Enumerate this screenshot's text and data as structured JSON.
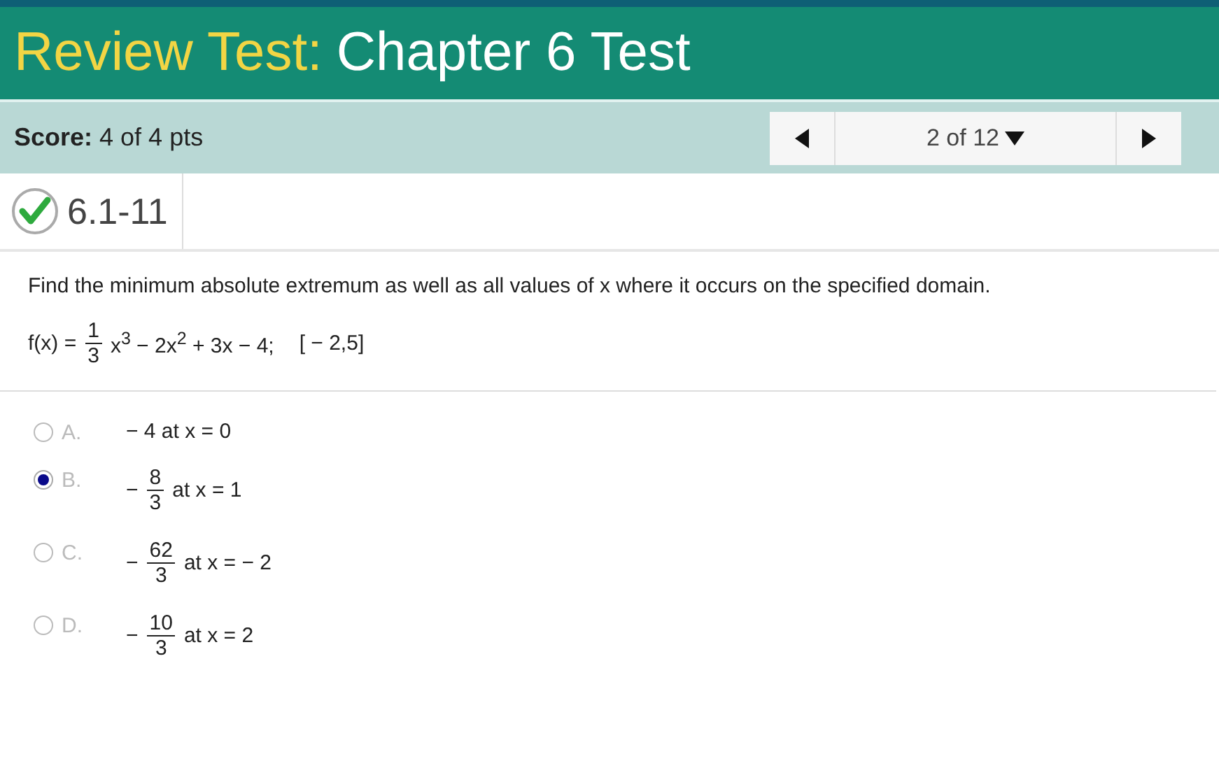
{
  "header": {
    "prefix": "Review Test:",
    "title": "Chapter 6 Test"
  },
  "score": {
    "label": "Score:",
    "value": "4 of 4 pts"
  },
  "nav": {
    "position": "2 of 12"
  },
  "question": {
    "id": "6.1-11",
    "correct": true
  },
  "prompt": "Find the minimum absolute extremum as well as all values of x where it occurs on the specified domain.",
  "formula": [
    {
      "kind": "text",
      "text": "f(x) ="
    },
    {
      "kind": "frac",
      "num": "1",
      "den": "3"
    },
    {
      "kind": "text",
      "text": "x$^{3}$ − 2x$^{2}$ + 3x − 4;"
    },
    {
      "kind": "text",
      "text": "[ − 2,5]"
    }
  ],
  "answers": [
    {
      "letter": "A.",
      "selected": false,
      "parts": [
        {
          "kind": "text",
          "text": "− 4 at x = 0"
        }
      ]
    },
    {
      "letter": "B.",
      "selected": true,
      "parts": [
        {
          "kind": "text",
          "text": "−"
        },
        {
          "kind": "frac",
          "num": "8",
          "den": "3"
        },
        {
          "kind": "text",
          "text": "at x = 1"
        }
      ]
    },
    {
      "letter": "C.",
      "selected": false,
      "parts": [
        {
          "kind": "text",
          "text": "−"
        },
        {
          "kind": "frac",
          "num": "62",
          "den": "3"
        },
        {
          "kind": "text",
          "text": "at x = − 2"
        }
      ]
    },
    {
      "letter": "D.",
      "selected": false,
      "parts": [
        {
          "kind": "text",
          "text": "−"
        },
        {
          "kind": "frac",
          "num": "10",
          "den": "3"
        },
        {
          "kind": "text",
          "text": "at x = 2"
        }
      ]
    }
  ]
}
